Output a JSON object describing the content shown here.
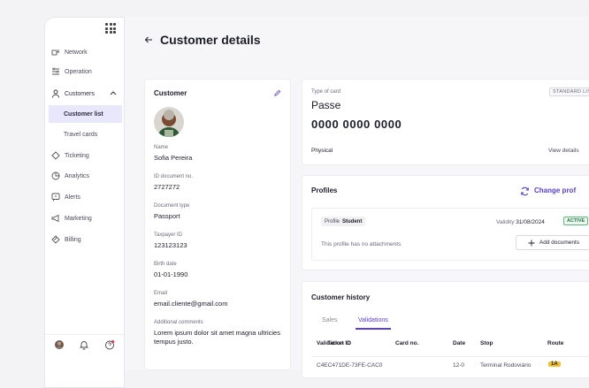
{
  "sidebar": {
    "items": [
      {
        "label": "Network",
        "icon": "network-icon"
      },
      {
        "label": "Operation",
        "icon": "operation-icon"
      },
      {
        "label": "Customers",
        "icon": "customers-icon"
      },
      {
        "label": "Ticketing",
        "icon": "ticketing-icon"
      },
      {
        "label": "Analytics",
        "icon": "analytics-icon"
      },
      {
        "label": "Alerts",
        "icon": "alerts-icon"
      },
      {
        "label": "Marketing",
        "icon": "marketing-icon"
      },
      {
        "label": "Billing",
        "icon": "billing-icon"
      }
    ],
    "customers_sub": [
      "Customer list",
      "Travel cards"
    ]
  },
  "page": {
    "title": "Customer details"
  },
  "customer": {
    "title": "Customer",
    "fields": [
      {
        "label": "Name",
        "value": "Sofia Pereira"
      },
      {
        "label": "ID document no.",
        "value": "2727272"
      },
      {
        "label": "Document type",
        "value": "Passport"
      },
      {
        "label": "Taxpayer ID",
        "value": "123123123"
      },
      {
        "label": "Birth date",
        "value": "01-01-1990"
      },
      {
        "label": "Email",
        "value": "email.cliente@gmail.com"
      },
      {
        "label": "Additional comments",
        "value": "Lorem ipsum dolor sit amet magna ultricies tempus justo."
      }
    ]
  },
  "travel_card": {
    "type_label": "Type of card",
    "type_name": "Passe",
    "badge": "STANDARD LIS",
    "number": "0000 0000 0000",
    "format": "Physical",
    "view_details": "View details"
  },
  "profiles": {
    "title": "Profiles",
    "change_label": "Change prof",
    "profile_key": "Profile",
    "profile_value": "Student",
    "validity_label": "Validity",
    "validity_date": "31/08/2024",
    "status": "ACTIVE",
    "no_attachments": "This profile has no attachments",
    "add_documents": "Add documents"
  },
  "history": {
    "title": "Customer history",
    "tabs": [
      "Sales",
      "Validations"
    ],
    "columns": [
      "Validation ID",
      "Ticket ID",
      "Card no.",
      "Date",
      "Stop",
      "Route"
    ],
    "row": {
      "id": "C4EC471DE-73FE-CAC0",
      "date": "12-0",
      "stop": "Terminal Rodoviário",
      "route": "1A"
    }
  },
  "colors": {
    "accent": "#5b3fd6",
    "active_bg": "#e9e7fb",
    "status_green": "#1e7a3c",
    "route_yellow": "#f2c12e"
  }
}
